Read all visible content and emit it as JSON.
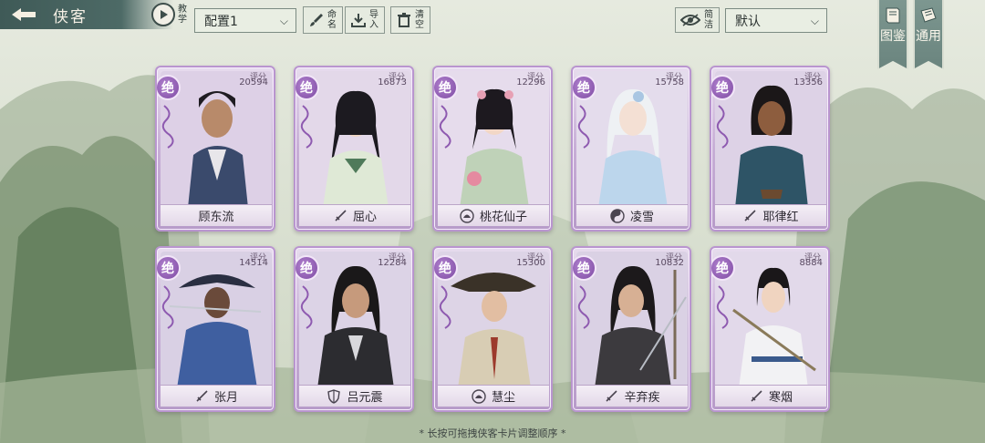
{
  "header": {
    "title": "侠客",
    "tutorial_label": "教学",
    "config_value": "配置1",
    "rename_label": "命名",
    "import_label": "导入",
    "clear_label": "清空",
    "filter_label": "简洁",
    "sort_value": "默认",
    "codex_label": "图鉴",
    "general_label": "通用"
  },
  "icons": {
    "back": "arrow-left-icon",
    "tutorial": "play-icon",
    "rename": "brush-icon",
    "import": "import-icon",
    "clear": "trash-icon",
    "filter": "eye-icon",
    "codex": "book-icon",
    "general": "scroll-icon"
  },
  "card_common": {
    "rank_label": "绝",
    "score_label": "评分"
  },
  "cards": [
    {
      "name": "顾东流",
      "score": "20594",
      "school_icon": ""
    },
    {
      "name": "屈心",
      "score": "16873",
      "school_icon": "sword-icon"
    },
    {
      "name": "桃花仙子",
      "score": "12296",
      "school_icon": "lotus-icon"
    },
    {
      "name": "凌雪",
      "score": "15758",
      "school_icon": "yinyang-icon"
    },
    {
      "name": "耶律红",
      "score": "13356",
      "school_icon": "sword-icon"
    },
    {
      "name": "张月",
      "score": "14514",
      "school_icon": "sword-icon"
    },
    {
      "name": "吕元震",
      "score": "12284",
      "school_icon": "shield-icon"
    },
    {
      "name": "慧尘",
      "score": "15300",
      "school_icon": "lotus-icon"
    },
    {
      "name": "辛弃疾",
      "score": "10832",
      "school_icon": "sword-icon"
    },
    {
      "name": "寒烟",
      "score": "8884",
      "school_icon": "sword-icon"
    }
  ],
  "footer": {
    "hint": "* 长按可拖拽侠客卡片调整顺序 *"
  },
  "colors": {
    "card_purple": "#c7aed6",
    "rank_purple": "#7e4aa3",
    "header_teal": "#4d6a66"
  }
}
